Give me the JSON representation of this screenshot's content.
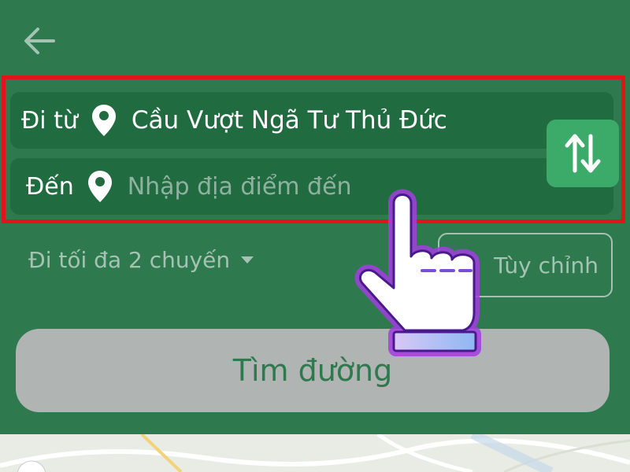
{
  "header": {
    "back_icon": "arrow-left-icon"
  },
  "route": {
    "from_label": "Đi từ",
    "from_value": "Cầu Vượt Ngã Tư Thủ Đức",
    "to_label": "Đến",
    "to_placeholder": "Nhập địa điểm đến",
    "to_value": "",
    "pin_icon": "map-pin-icon",
    "swap_icon": "swap-vertical-icon"
  },
  "options": {
    "max_trips": "Đi tối đa 2 chuyến",
    "custom": "Tùy chỉnh"
  },
  "search_button": "Tìm đường",
  "overlay": {
    "pointer_icon": "pointing-hand-icon"
  },
  "colors": {
    "background": "#2e7a4e",
    "field": "#206b40",
    "highlight": "#e3131b",
    "swap": "#3cab6a",
    "muted": "#a4c3b2",
    "search_button": "#b0b4b2"
  }
}
